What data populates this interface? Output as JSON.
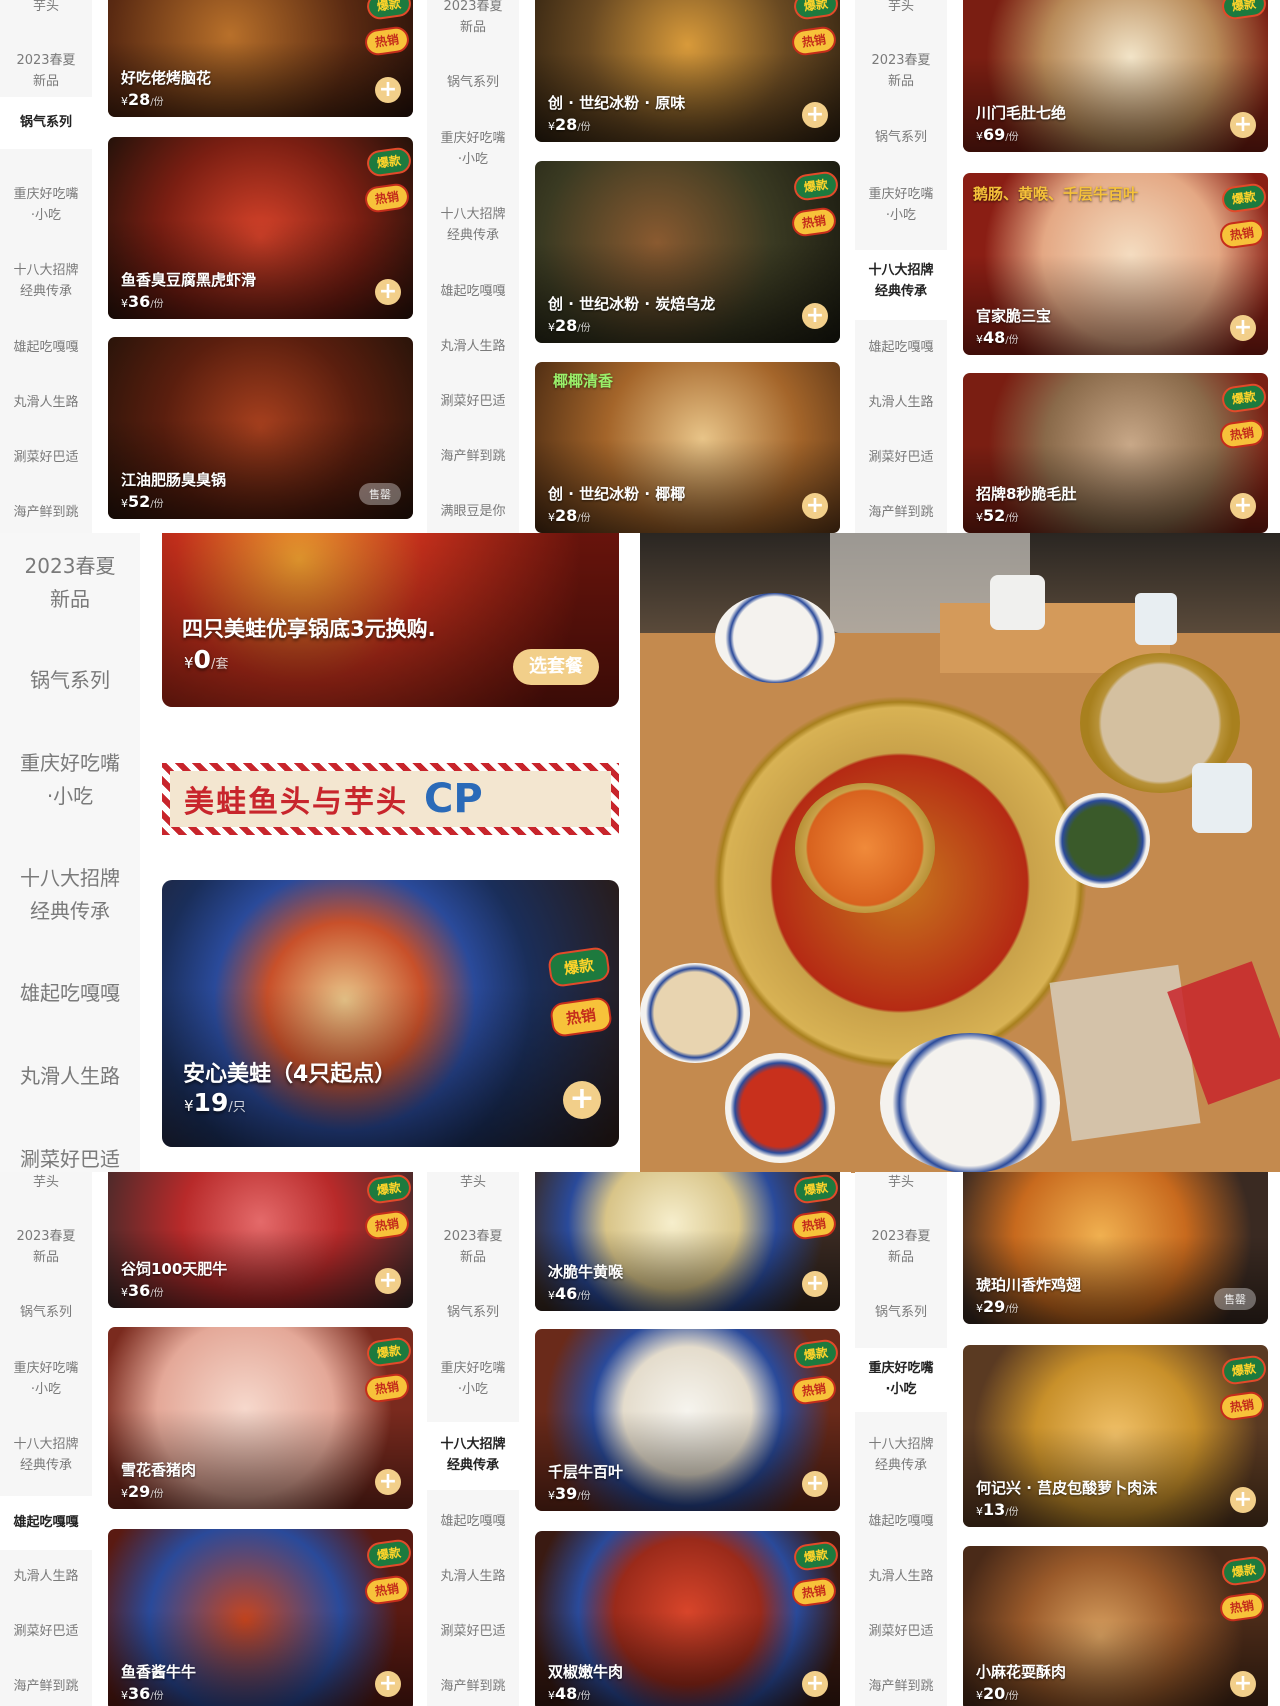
{
  "sidebar_a": [
    "芋头",
    "2023春夏\n新品",
    "锅气系列",
    "重庆好吃嘴\n·小吃",
    "十八大招牌\n经典传承",
    "雄起吃嘎嘎",
    "丸滑人生路",
    "涮菜好巴适",
    "海产鲜到跳"
  ],
  "sidebar_b": [
    "2023春夏\n新品",
    "锅气系列",
    "重庆好吃嘴\n·小吃",
    "十八大招牌\n经典传承",
    "雄起吃嘎嘎",
    "丸滑人生路",
    "涮菜好巴适",
    "海产鲜到跳",
    "满眼豆是你"
  ],
  "sidebar_mid": [
    "2023春夏\n新品",
    "锅气系列",
    "重庆好吃嘴\n·小吃",
    "十八大招牌\n经典传承",
    "雄起吃嘎嘎",
    "丸滑人生路",
    "涮菜好巴适"
  ],
  "sidebar_bottom": [
    "芋头",
    "2023春夏\n新品",
    "锅气系列",
    "重庆好吃嘴\n·小吃",
    "十八大招牌\n经典传承",
    "雄起吃嘎嘎",
    "丸滑人生路",
    "涮菜好巴适",
    "海产鲜到跳"
  ],
  "panel1": [
    {
      "name": "好吃佬烤脑花",
      "yen": "¥",
      "price": "28",
      "unit": "/份"
    },
    {
      "name": "鱼香臭豆腐黑虎虾滑",
      "yen": "¥",
      "price": "36",
      "unit": "/份"
    },
    {
      "name": "江油肥肠臭臭锅",
      "yen": "¥",
      "price": "52",
      "unit": "/份"
    }
  ],
  "panel2": [
    {
      "name": "创 · 世纪冰粉 · 原味",
      "yen": "¥",
      "price": "28",
      "unit": "/份"
    },
    {
      "name": "创 · 世纪冰粉 · 炭焙乌龙",
      "yen": "¥",
      "price": "28",
      "unit": "/份"
    },
    {
      "name": "创 · 世纪冰粉 · 椰椰",
      "yen": "¥",
      "price": "28",
      "unit": "/份",
      "tag": "椰椰清香"
    }
  ],
  "panel3": [
    {
      "name": "川门毛肚七绝",
      "yen": "¥",
      "price": "69",
      "unit": "/份"
    },
    {
      "name": "官家脆三宝",
      "yen": "¥",
      "price": "48",
      "unit": "/份",
      "tag": "鹅肠、黄喉、千层牛百叶"
    },
    {
      "name": "招牌8秒脆毛肚",
      "yen": "¥",
      "price": "52",
      "unit": "/份"
    }
  ],
  "panel4": [
    {
      "name": "谷饲100天肥牛",
      "yen": "¥",
      "price": "36",
      "unit": "/份"
    },
    {
      "name": "雪花香猪肉",
      "yen": "¥",
      "price": "29",
      "unit": "/份"
    },
    {
      "name": "鱼香酱牛牛",
      "yen": "¥",
      "price": "36",
      "unit": "/份"
    }
  ],
  "panel5": [
    {
      "name": "冰脆牛黄喉",
      "yen": "¥",
      "price": "46",
      "unit": "/份"
    },
    {
      "name": "千层牛百叶",
      "yen": "¥",
      "price": "39",
      "unit": "/份"
    },
    {
      "name": "双椒嫩牛肉",
      "yen": "¥",
      "price": "48",
      "unit": "/份"
    }
  ],
  "panel6": [
    {
      "name": "琥珀川香炸鸡翅",
      "yen": "¥",
      "price": "29",
      "unit": "/份"
    },
    {
      "name": "何记兴 · 莒皮包酸萝卜肉沫",
      "yen": "¥",
      "price": "13",
      "unit": "/份"
    },
    {
      "name": "小麻花耍酥肉",
      "yen": "¥",
      "price": "20",
      "unit": "/份"
    }
  ],
  "labels": {
    "sold": "售罄",
    "add": "+",
    "badge1": "爆款",
    "badge2": "热销"
  },
  "mid": {
    "hero1_name": "四只美蛙优享锅底3元换购.",
    "hero1_yen": "¥",
    "hero1_price": "0",
    "hero1_unit": "/套",
    "hero1_button": "选套餐",
    "banner": "美蛙鱼头与芋头",
    "banner_cp": "CP",
    "hero2_name": "安心美蛙（4只起点）",
    "hero2_yen": "¥",
    "hero2_price": "19",
    "hero2_unit": "/只"
  },
  "colors": {
    "accent": "#f2cf8a",
    "sidebar_bg": "#f6f6f6",
    "banner_red": "#c8252c"
  }
}
